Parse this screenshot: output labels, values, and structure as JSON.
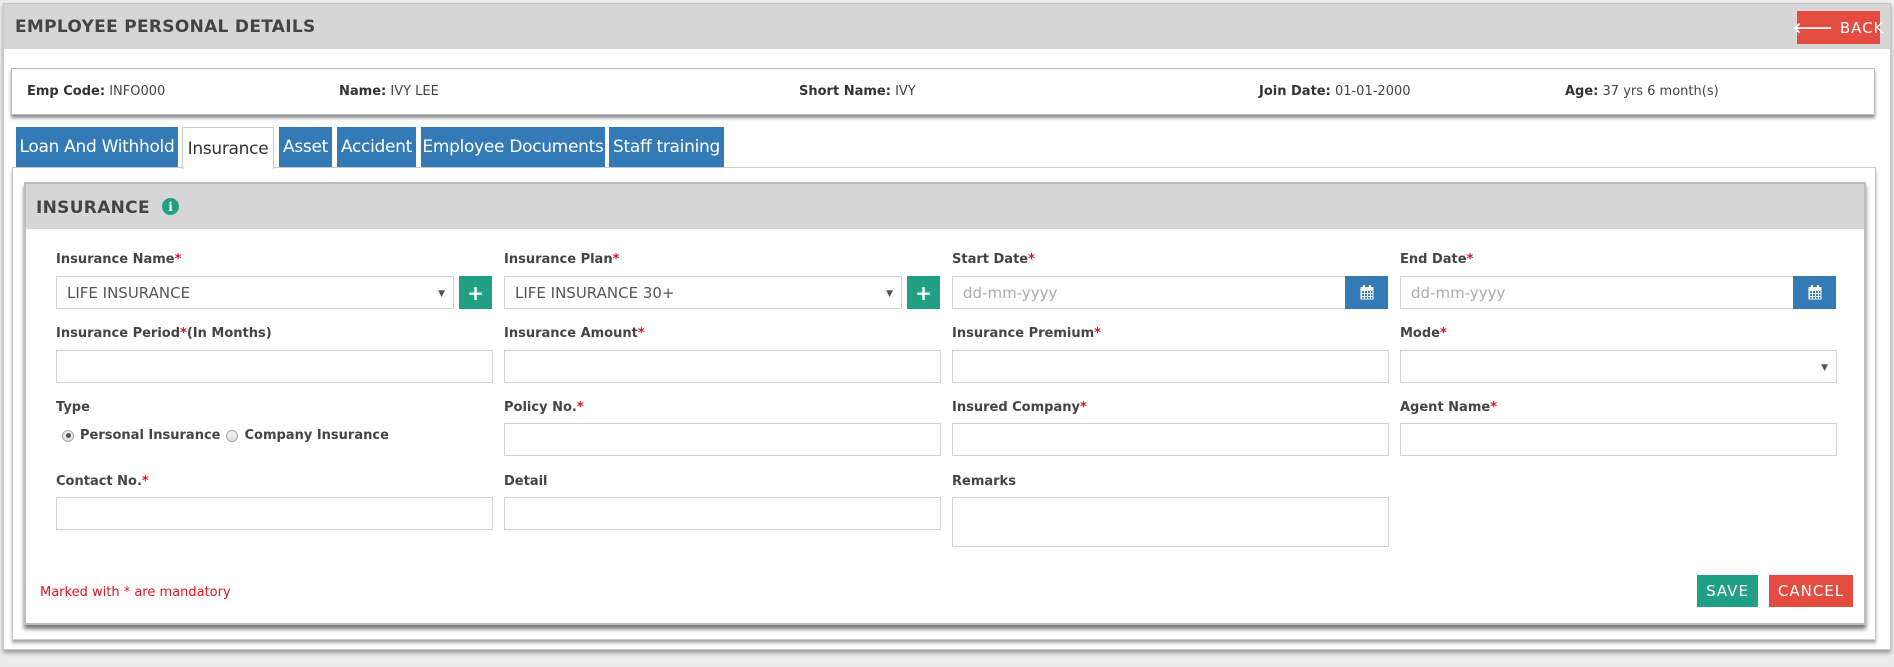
{
  "header": {
    "title": "EMPLOYEE PERSONAL DETAILS",
    "back_label": "BACK",
    "back_icon": "arrow-left-icon"
  },
  "employee": {
    "emp_code_label": "Emp Code:",
    "emp_code": "INFO000",
    "name_label": "Name:",
    "name": "IVY LEE",
    "short_name_label": "Short Name:",
    "short_name": "IVY",
    "join_date_label": "Join Date:",
    "join_date": "01-01-2000",
    "age_label": "Age:",
    "age": "37 yrs 6 month(s)"
  },
  "tabs": [
    {
      "label": "Loan And Withhold",
      "active": false
    },
    {
      "label": "Insurance",
      "active": true
    },
    {
      "label": "Asset",
      "active": false
    },
    {
      "label": "Accident",
      "active": false
    },
    {
      "label": "Employee Documents",
      "active": false
    },
    {
      "label": "Staff training",
      "active": false
    }
  ],
  "insurance": {
    "title": "INSURANCE",
    "info_icon": "info-icon",
    "required_marker": "*",
    "fields": {
      "insurance_name": {
        "label": "Insurance Name",
        "value": "LIFE INSURANCE",
        "required": true
      },
      "insurance_plan": {
        "label": "Insurance Plan",
        "value": "LIFE INSURANCE 30+",
        "required": true
      },
      "start_date": {
        "label": "Start Date",
        "placeholder": "dd-mm-yyyy",
        "value": "",
        "required": true
      },
      "end_date": {
        "label": "End Date",
        "placeholder": "dd-mm-yyyy",
        "value": "",
        "required": true
      },
      "insurance_period": {
        "label": "Insurance Period",
        "suffix": "(In Months)",
        "value": "",
        "required": true
      },
      "insurance_amount": {
        "label": "Insurance Amount",
        "value": "",
        "required": true
      },
      "insurance_premium": {
        "label": "Insurance Premium",
        "value": "",
        "required": true
      },
      "mode": {
        "label": "Mode",
        "value": "",
        "required": true
      },
      "type": {
        "label": "Type",
        "options": [
          "Personal Insurance",
          "Company Insurance"
        ],
        "selected": "Personal Insurance"
      },
      "policy_no": {
        "label": "Policy No.",
        "value": "",
        "required": true
      },
      "insured_company": {
        "label": "Insured Company",
        "value": "",
        "required": true
      },
      "agent_name": {
        "label": "Agent Name",
        "value": "",
        "required": true
      },
      "contact_no": {
        "label": "Contact No.",
        "value": "",
        "required": true
      },
      "detail": {
        "label": "Detail",
        "value": "",
        "required": false
      },
      "remarks": {
        "label": "Remarks",
        "value": "",
        "required": false
      }
    },
    "mandatory_note": "Marked with * are mandatory",
    "save_label": "SAVE",
    "cancel_label": "CANCEL"
  },
  "colors": {
    "primary_blue": "#337ab7",
    "success_green": "#22a085",
    "danger_red": "#e44c41",
    "required_red": "#e3121d",
    "header_gray": "#d6d6d6"
  }
}
